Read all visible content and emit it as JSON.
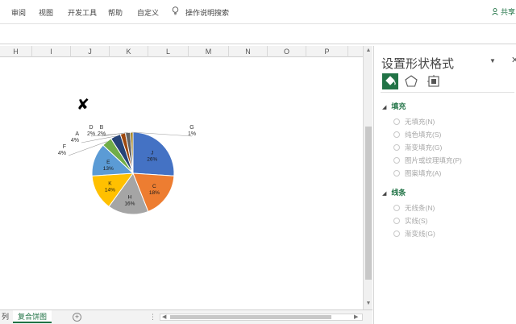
{
  "ribbon": {
    "tabs": [
      "审阅",
      "视图",
      "开发工具",
      "帮助",
      "自定义"
    ],
    "tell_me": "操作说明搜索",
    "share": "共享"
  },
  "columns": [
    "H",
    "I",
    "J",
    "K",
    "L",
    "M",
    "N",
    "O",
    "P"
  ],
  "sheet_tabs": {
    "partial": "列",
    "active": "复合饼图"
  },
  "pane": {
    "title": "设置形状格式",
    "fill_section": "填充",
    "fill_options": [
      "无填充(N)",
      "纯色填充(S)",
      "渐变填充(G)",
      "图片或纹理填充(P)",
      "图案填充(A)"
    ],
    "line_section": "线条",
    "line_options": [
      "无线条(N)",
      "实线(S)",
      "渐变线(G)"
    ]
  },
  "chart_data": {
    "type": "pie",
    "slices": [
      {
        "label": "J",
        "value": 26,
        "text": "26%",
        "color": "#4472c4"
      },
      {
        "label": "C",
        "value": 18,
        "text": "18%",
        "color": "#ed7d31"
      },
      {
        "label": "H",
        "value": 16,
        "text": "16%",
        "color": "#a5a5a5"
      },
      {
        "label": "K",
        "value": 14,
        "text": "14%",
        "color": "#ffc000"
      },
      {
        "label": "E",
        "value": 13,
        "text": "13%",
        "color": "#5b9bd5"
      },
      {
        "label": "F",
        "value": 4,
        "text": "4%",
        "color": "#70ad47"
      },
      {
        "label": "A",
        "value": 4,
        "text": "4%",
        "color": "#264478"
      },
      {
        "label": "D",
        "value": 2,
        "text": "2%",
        "color": "#9e480e"
      },
      {
        "label": "B",
        "value": 2,
        "text": "2%",
        "color": "#636363"
      },
      {
        "label": "G",
        "value": 1,
        "text": "1%",
        "color": "#997300"
      }
    ]
  }
}
